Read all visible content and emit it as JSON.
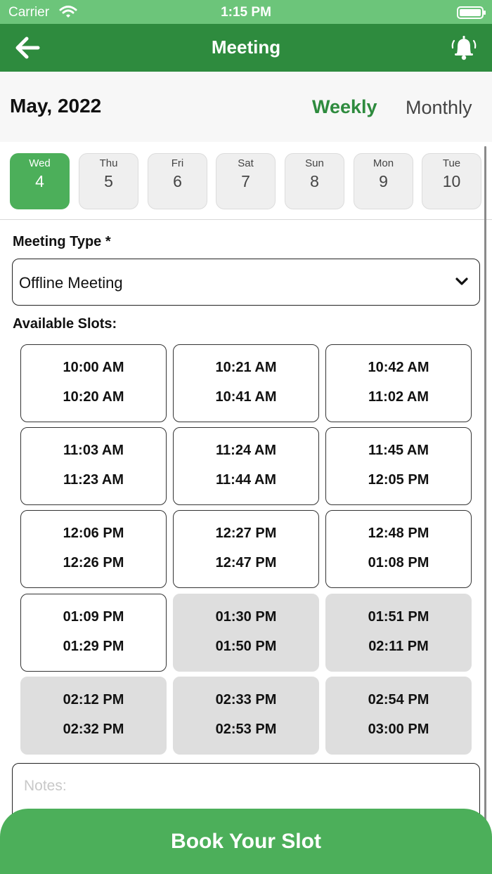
{
  "status_bar": {
    "carrier": "Carrier",
    "time": "1:15 PM"
  },
  "nav": {
    "title": "Meeting",
    "back_icon": "arrow-left-icon",
    "bell_icon": "bell-icon"
  },
  "calendar": {
    "month": "May, 2022",
    "tabs": [
      {
        "label": "Weekly",
        "active": true
      },
      {
        "label": "Monthly",
        "active": false
      }
    ],
    "days": [
      {
        "name": "Wed",
        "num": "4",
        "selected": true
      },
      {
        "name": "Thu",
        "num": "5",
        "selected": false
      },
      {
        "name": "Fri",
        "num": "6",
        "selected": false
      },
      {
        "name": "Sat",
        "num": "7",
        "selected": false
      },
      {
        "name": "Sun",
        "num": "8",
        "selected": false
      },
      {
        "name": "Mon",
        "num": "9",
        "selected": false
      },
      {
        "name": "Tue",
        "num": "10",
        "selected": false
      }
    ]
  },
  "meeting_type": {
    "label": "Meeting Type *",
    "value": "Offline Meeting"
  },
  "slots": {
    "label": "Available Slots:",
    "items": [
      {
        "start": "10:00 AM",
        "end": "10:20 AM",
        "available": true
      },
      {
        "start": "10:21 AM",
        "end": "10:41 AM",
        "available": true
      },
      {
        "start": "10:42 AM",
        "end": "11:02 AM",
        "available": true
      },
      {
        "start": "11:03 AM",
        "end": "11:23 AM",
        "available": true
      },
      {
        "start": "11:24 AM",
        "end": "11:44 AM",
        "available": true
      },
      {
        "start": "11:45 AM",
        "end": "12:05 PM",
        "available": true
      },
      {
        "start": "12:06 PM",
        "end": "12:26 PM",
        "available": true
      },
      {
        "start": "12:27 PM",
        "end": "12:47 PM",
        "available": true
      },
      {
        "start": "12:48 PM",
        "end": "01:08 PM",
        "available": true
      },
      {
        "start": "01:09 PM",
        "end": "01:29 PM",
        "available": true
      },
      {
        "start": "01:30 PM",
        "end": "01:50 PM",
        "available": false
      },
      {
        "start": "01:51 PM",
        "end": "02:11 PM",
        "available": false
      },
      {
        "start": "02:12 PM",
        "end": "02:32 PM",
        "available": false
      },
      {
        "start": "02:33 PM",
        "end": "02:53 PM",
        "available": false
      },
      {
        "start": "02:54 PM",
        "end": "03:00 PM",
        "available": false
      }
    ]
  },
  "notes": {
    "placeholder": "Notes:",
    "value": ""
  },
  "book_button": {
    "label": "Book Your Slot"
  },
  "colors": {
    "primary": "#2e8b3e",
    "accent": "#4caf5a",
    "status_bar": "#6cc57a",
    "unavailable": "#dedede"
  }
}
